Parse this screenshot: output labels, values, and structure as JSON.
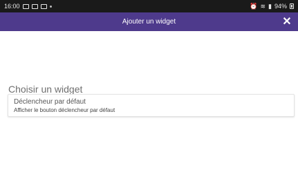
{
  "status_bar": {
    "time": "16:00",
    "battery": "94%",
    "icons_left": [
      "image-icon",
      "cast-icon",
      "gallery-icon",
      "more-dots-icon"
    ],
    "icons_right": [
      "alarm-icon",
      "wifi-icon",
      "signal-icon",
      "battery-icon"
    ]
  },
  "header": {
    "title": "Ajouter un widget",
    "close_icon": "close-icon",
    "background": "#4e3a8c"
  },
  "main": {
    "section_title": "Choisir un widget",
    "widgets": [
      {
        "name": "Déclencheur par défaut",
        "description": "Afficher le bouton déclencheur par défaut"
      }
    ]
  }
}
